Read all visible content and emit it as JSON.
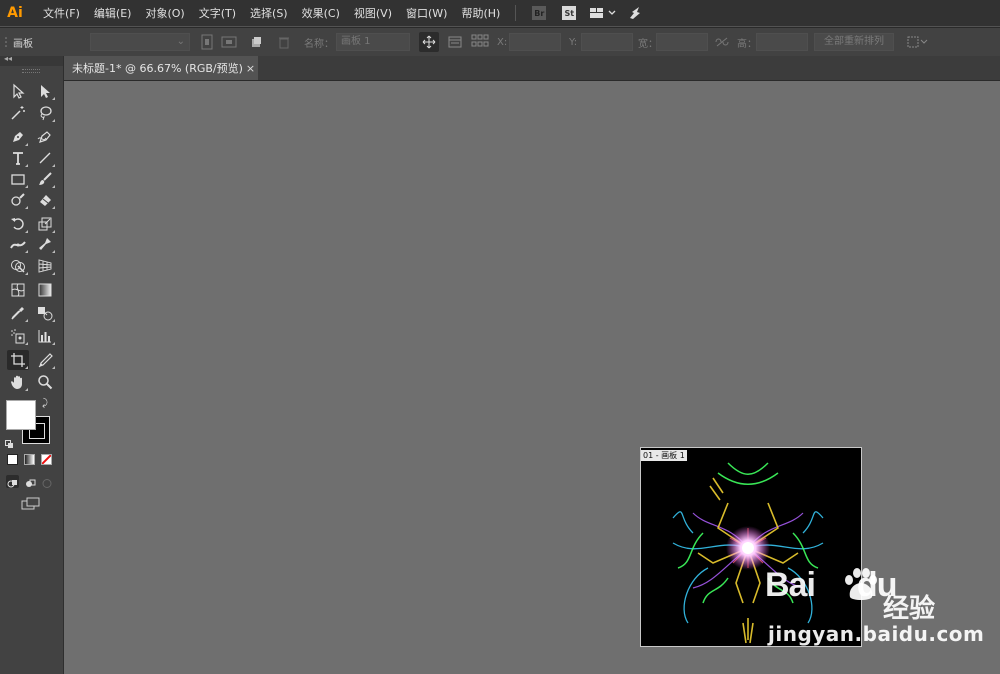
{
  "app": {
    "logo": "Ai"
  },
  "menu": [
    "文件(F)",
    "编辑(E)",
    "对象(O)",
    "文字(T)",
    "选择(S)",
    "效果(C)",
    "视图(V)",
    "窗口(W)",
    "帮助(H)"
  ],
  "app_buttons": {
    "bridge": "Br",
    "stock": "St"
  },
  "control_bar": {
    "panel_label": "画板",
    "name_label": "名称：",
    "name_value": "画板 1",
    "x_label": "X:",
    "y_label": "Y:",
    "width_label": "宽：",
    "height_label": "高：",
    "rearrange_label": "全部重新排列"
  },
  "document_tab": {
    "title": "未标题-1* @ 66.67% (RGB/预览)",
    "close": "×"
  },
  "artboard": {
    "label": "01 - 画板 1"
  },
  "tools": [
    {
      "name": "selection-tool-icon"
    },
    {
      "name": "direct-selection-tool-icon"
    },
    {
      "name": "magic-wand-tool-icon"
    },
    {
      "name": "lasso-tool-icon"
    },
    {
      "name": "pen-tool-icon"
    },
    {
      "name": "curvature-tool-icon"
    },
    {
      "name": "type-tool-icon"
    },
    {
      "name": "line-segment-tool-icon"
    },
    {
      "name": "rectangle-tool-icon"
    },
    {
      "name": "paintbrush-tool-icon"
    },
    {
      "name": "shaper-tool-icon"
    },
    {
      "name": "eraser-tool-icon"
    },
    {
      "name": "rotate-tool-icon"
    },
    {
      "name": "scale-tool-icon"
    },
    {
      "name": "width-tool-icon"
    },
    {
      "name": "puppet-warp-tool-icon"
    },
    {
      "name": "shape-builder-tool-icon"
    },
    {
      "name": "perspective-grid-tool-icon"
    },
    {
      "name": "mesh-tool-icon"
    },
    {
      "name": "gradient-tool-icon"
    },
    {
      "name": "eyedropper-tool-icon"
    },
    {
      "name": "blend-tool-icon"
    },
    {
      "name": "symbol-sprayer-tool-icon"
    },
    {
      "name": "column-graph-tool-icon"
    },
    {
      "name": "artboard-tool-icon"
    },
    {
      "name": "slice-tool-icon"
    },
    {
      "name": "hand-tool-icon"
    },
    {
      "name": "zoom-tool-icon"
    }
  ],
  "active_tool": "artboard-tool-icon",
  "colors": {
    "fill": "#ffffff",
    "stroke": "#000000",
    "menubar": "#323232",
    "panel": "#424242",
    "canvas": "#6f6f6f"
  },
  "watermark": {
    "brand": "Bai",
    "brand_suffix": "du",
    "cn": "经验",
    "url": "jingyan.baidu.com"
  }
}
